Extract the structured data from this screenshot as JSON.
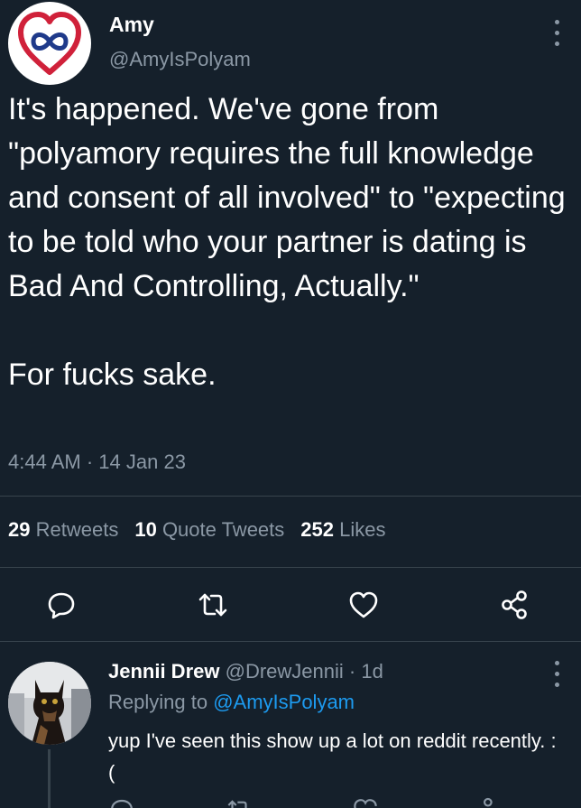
{
  "tweet": {
    "author_name": "Amy",
    "author_handle": "@AmyIsPolyam",
    "text": "It's happened. We've gone from \"polyamory requires the full knowledge and consent of all involved\" to \"expecting to be told who your partner is dating is Bad And Controlling, Actually.\"\n\nFor fucks sake.",
    "time": "4:44 AM",
    "date": "14 Jan 23",
    "stats": {
      "retweets_count": "29",
      "retweets_label": "Retweets",
      "quotes_count": "10",
      "quotes_label": "Quote Tweets",
      "likes_count": "252",
      "likes_label": "Likes"
    }
  },
  "reply": {
    "author_name": "Jennii Drew",
    "author_handle": "@DrewJennii",
    "age": "1d",
    "replying_label": "Replying to",
    "replying_handle": "@AmyIsPolyam",
    "text": "yup I've seen this show up  a lot on reddit recently. :("
  },
  "icons": {
    "reply": "comment-icon",
    "retweet": "retweet-icon",
    "like": "heart-icon",
    "share": "share-icon",
    "more": "more-vertical-icon"
  },
  "colors": {
    "background": "#15202b",
    "text": "#ffffff",
    "muted": "#8b98a5",
    "link": "#1d9bf0",
    "divider": "#38444d",
    "logo_red": "#d0213a"
  }
}
